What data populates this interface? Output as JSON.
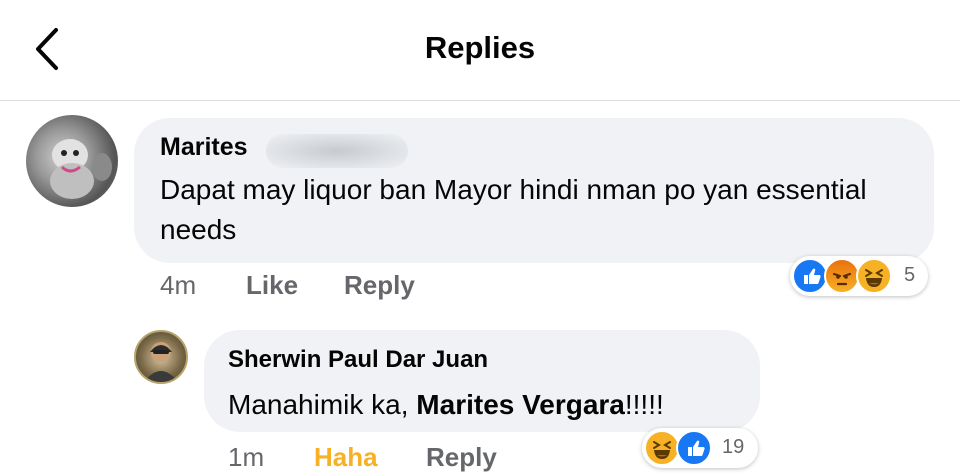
{
  "header": {
    "title": "Replies",
    "back_icon": "chevron-left-icon"
  },
  "comments": [
    {
      "author": "Marites",
      "author_redacted": true,
      "text": "Dapat may liquor ban Mayor hindi nman po yan essential needs",
      "time": "4m",
      "actions": [
        "Like",
        "Reply"
      ],
      "reactions": {
        "types": [
          "like",
          "angry",
          "haha"
        ],
        "count": "5"
      }
    },
    {
      "author": "Sherwin Paul Dar Juan",
      "text_prefix": "Manahimik ka, ",
      "mention": "Marites Vergara",
      "text_suffix": "!!!!!",
      "time": "1m",
      "actions": [
        "Haha",
        "Reply"
      ],
      "user_reaction": "Haha",
      "reactions": {
        "types": [
          "haha",
          "like"
        ],
        "count": "19"
      }
    }
  ],
  "colors": {
    "bubble": "#f0f2f5",
    "secondary_text": "#65676b",
    "like_blue": "#1877f2",
    "haha_yellow": "#f7b125"
  }
}
